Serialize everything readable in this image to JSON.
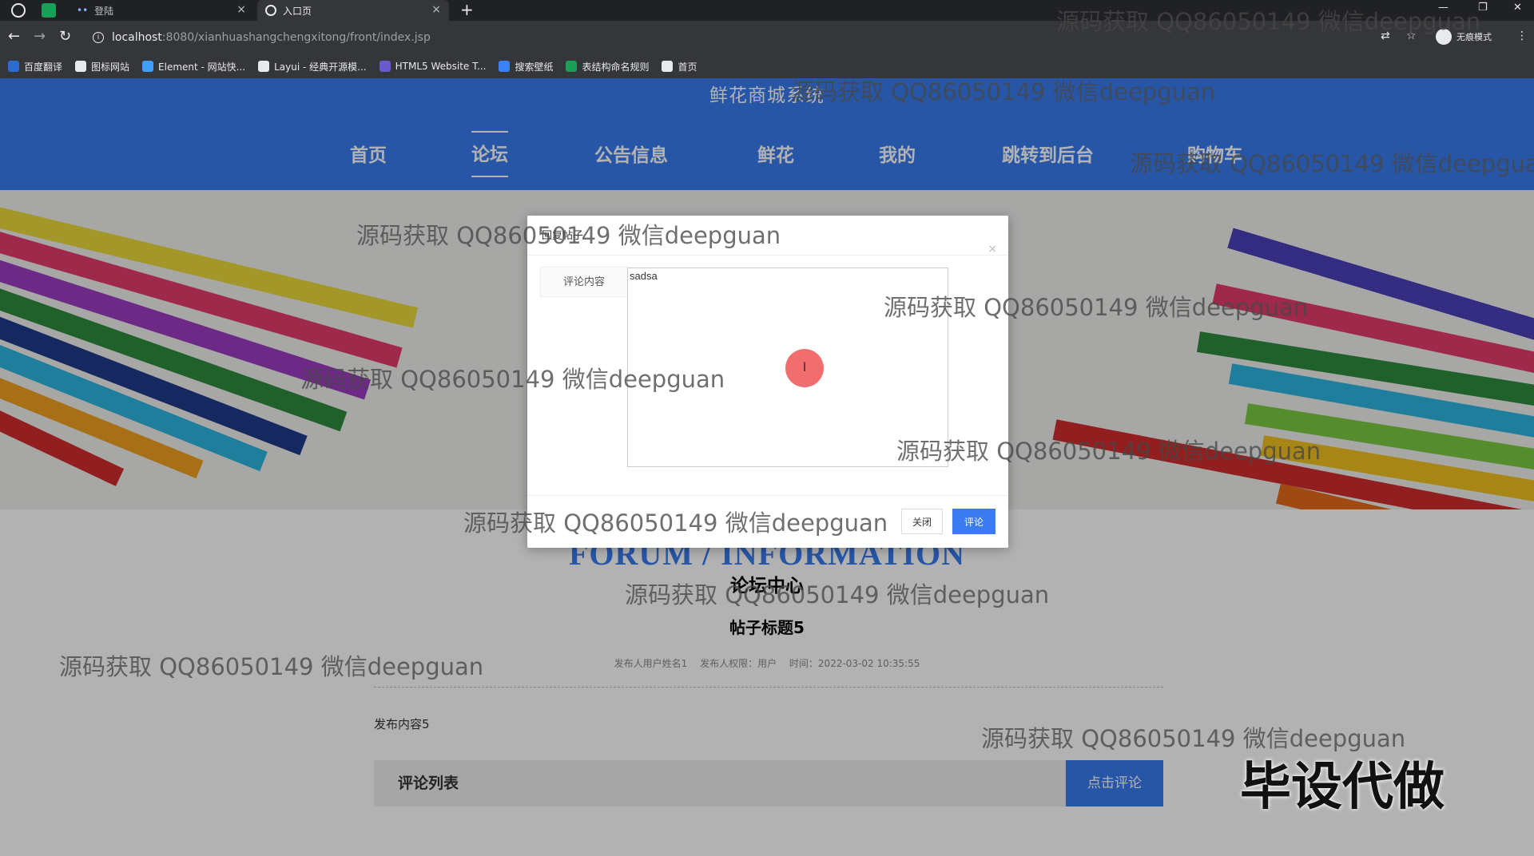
{
  "browser": {
    "tabs": [
      {
        "label": "登陆",
        "close": "×"
      },
      {
        "label": "入口页",
        "close": "×"
      }
    ],
    "new_tab": "+",
    "window_controls": [
      "—",
      "❐",
      "✕"
    ],
    "url_host": "localhost",
    "url_path": ":8080/xianhuashangchengxitong/front/index.jsp",
    "incognito_label": "无痕模式",
    "bookmarks": [
      {
        "label": "百度翻译",
        "icon": "translate-icon",
        "color": "#2a6bd6"
      },
      {
        "label": "图标网站",
        "icon": "flag-icon",
        "color": "#e8eaed"
      },
      {
        "label": "Element - 网站快...",
        "icon": "element-icon",
        "color": "#409eff"
      },
      {
        "label": "Layui - 经典开源模...",
        "icon": "layui-icon",
        "color": "#e8eaed"
      },
      {
        "label": "HTML5 Website T...",
        "icon": "html5-icon",
        "color": "#6a5acd"
      },
      {
        "label": "搜索壁纸",
        "icon": "wallpaper-icon",
        "color": "#3b82f6"
      },
      {
        "label": "表结构命名规则",
        "icon": "table-icon",
        "color": "#18a058"
      },
      {
        "label": "首页",
        "icon": "globe-icon",
        "color": "#e8eaed"
      }
    ]
  },
  "site": {
    "title": "鲜花商城系统",
    "nav": [
      "首页",
      "论坛",
      "公告信息",
      "鲜花",
      "我的",
      "跳转到后台",
      "购物车"
    ],
    "active_nav": "论坛",
    "accent_color": "#3a7bf0"
  },
  "forum": {
    "heading_en": "FORUM / INFORMATION",
    "heading_cn": "论坛中心",
    "post_title": "帖子标题5",
    "meta": {
      "author": "发布人用户姓名1",
      "role": "发布人权限：用户",
      "time": "时间：2022-03-02 10:35:55"
    },
    "content": "发布内容5",
    "comment_list_label": "评论列表",
    "comment_button": "点击评论"
  },
  "modal": {
    "title": "回复帖子",
    "close_icon": "×",
    "field_label": "评论内容",
    "textarea_value": "sadsa",
    "cursor_glyph": "I",
    "close_button": "关闭",
    "submit_button": "评论"
  },
  "watermarks": {
    "text": "源码获取 QQ86050149 微信deepguan",
    "tag": "毕设代做"
  }
}
